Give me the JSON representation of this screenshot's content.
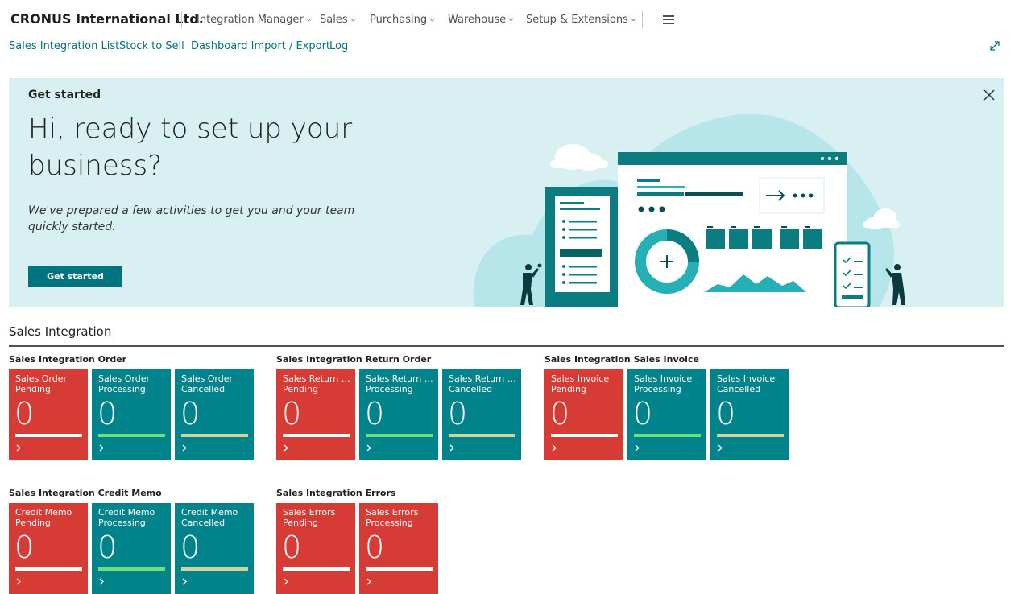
{
  "company": "CRONUS International Ltd.",
  "nav": {
    "menus": [
      "Integration Manager",
      "Sales",
      "Purchasing",
      "Warehouse",
      "Setup & Extensions"
    ],
    "sublinks": [
      "Sales Integration List",
      "Stock to Sell",
      "Dashboard Import / Export",
      "Log"
    ]
  },
  "banner": {
    "label": "Get started",
    "title": "Hi, ready to set up your business?",
    "description": "We've prepared a few activities to get you and your team quickly started.",
    "button": "Get started"
  },
  "section": {
    "title": "Sales Integration",
    "groups": [
      {
        "title": "Sales Integration Order",
        "tiles": [
          {
            "line1": "Sales Order",
            "line2": "Pending",
            "value": "0",
            "status": "pending"
          },
          {
            "line1": "Sales Order",
            "line2": "Processing",
            "value": "0",
            "status": "processing"
          },
          {
            "line1": "Sales Order",
            "line2": "Cancelled",
            "value": "0",
            "status": "cancelled"
          }
        ]
      },
      {
        "title": "Sales Integration Return Order",
        "tiles": [
          {
            "line1": "Sales Return O...",
            "line2": "Pending",
            "value": "0",
            "status": "pending"
          },
          {
            "line1": "Sales Return O...",
            "line2": "Processing",
            "value": "0",
            "status": "processing"
          },
          {
            "line1": "Sales Return O...",
            "line2": "Cancelled",
            "value": "0",
            "status": "cancelled"
          }
        ]
      },
      {
        "title": "Sales Integration Sales Invoice",
        "tiles": [
          {
            "line1": "Sales Invoice",
            "line2": "Pending",
            "value": "0",
            "status": "pending"
          },
          {
            "line1": "Sales Invoice",
            "line2": "Processing",
            "value": "0",
            "status": "processing"
          },
          {
            "line1": "Sales Invoice",
            "line2": "Cancelled",
            "value": "0",
            "status": "cancelled"
          }
        ]
      },
      {
        "title": "Sales Integration Credit Memo",
        "tiles": [
          {
            "line1": "Credit Memo",
            "line2": "Pending",
            "value": "0",
            "status": "pending"
          },
          {
            "line1": "Credit Memo",
            "line2": "Processing",
            "value": "0",
            "status": "processing"
          },
          {
            "line1": "Credit Memo",
            "line2": "Cancelled",
            "value": "0",
            "status": "cancelled"
          }
        ]
      },
      {
        "title": "Sales Integration Errors",
        "tiles": [
          {
            "line1": "Sales Errors",
            "line2": "Pending",
            "value": "0",
            "status": "pending"
          },
          {
            "line1": "Sales Errors",
            "line2": "Processing",
            "value": "0",
            "status": "error"
          }
        ]
      }
    ]
  },
  "colors": {
    "accent": "#00747e",
    "banner_bg": "#d9f0f2",
    "tile_red": "#d63b35",
    "tile_teal": "#00838a",
    "bar_pending": "#ffffff",
    "bar_processing": "#6fe07a",
    "bar_cancelled": "#d8d09a"
  },
  "icons": {
    "menu": "hamburger-icon",
    "expand": "expand-icon",
    "close": "close-icon",
    "tile_drill": "chevron-right-icon",
    "nav_dropdown": "chevron-down-icon"
  }
}
